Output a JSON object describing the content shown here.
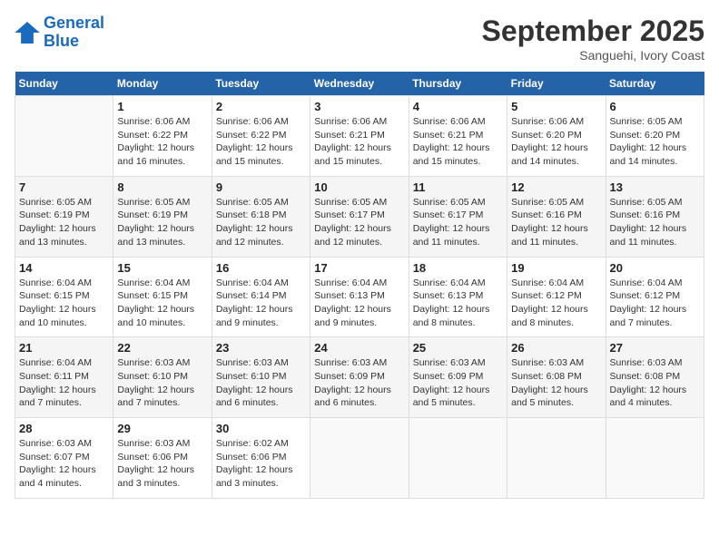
{
  "header": {
    "logo_line1": "General",
    "logo_line2": "Blue",
    "month_year": "September 2025",
    "location": "Sanguehi, Ivory Coast"
  },
  "weekdays": [
    "Sunday",
    "Monday",
    "Tuesday",
    "Wednesday",
    "Thursday",
    "Friday",
    "Saturday"
  ],
  "weeks": [
    [
      {
        "day": "",
        "sunrise": "",
        "sunset": "",
        "daylight": ""
      },
      {
        "day": "1",
        "sunrise": "6:06 AM",
        "sunset": "6:22 PM",
        "daylight": "12 hours and 16 minutes."
      },
      {
        "day": "2",
        "sunrise": "6:06 AM",
        "sunset": "6:22 PM",
        "daylight": "12 hours and 15 minutes."
      },
      {
        "day": "3",
        "sunrise": "6:06 AM",
        "sunset": "6:21 PM",
        "daylight": "12 hours and 15 minutes."
      },
      {
        "day": "4",
        "sunrise": "6:06 AM",
        "sunset": "6:21 PM",
        "daylight": "12 hours and 15 minutes."
      },
      {
        "day": "5",
        "sunrise": "6:06 AM",
        "sunset": "6:20 PM",
        "daylight": "12 hours and 14 minutes."
      },
      {
        "day": "6",
        "sunrise": "6:05 AM",
        "sunset": "6:20 PM",
        "daylight": "12 hours and 14 minutes."
      }
    ],
    [
      {
        "day": "7",
        "sunrise": "6:05 AM",
        "sunset": "6:19 PM",
        "daylight": "12 hours and 13 minutes."
      },
      {
        "day": "8",
        "sunrise": "6:05 AM",
        "sunset": "6:19 PM",
        "daylight": "12 hours and 13 minutes."
      },
      {
        "day": "9",
        "sunrise": "6:05 AM",
        "sunset": "6:18 PM",
        "daylight": "12 hours and 12 minutes."
      },
      {
        "day": "10",
        "sunrise": "6:05 AM",
        "sunset": "6:17 PM",
        "daylight": "12 hours and 12 minutes."
      },
      {
        "day": "11",
        "sunrise": "6:05 AM",
        "sunset": "6:17 PM",
        "daylight": "12 hours and 11 minutes."
      },
      {
        "day": "12",
        "sunrise": "6:05 AM",
        "sunset": "6:16 PM",
        "daylight": "12 hours and 11 minutes."
      },
      {
        "day": "13",
        "sunrise": "6:05 AM",
        "sunset": "6:16 PM",
        "daylight": "12 hours and 11 minutes."
      }
    ],
    [
      {
        "day": "14",
        "sunrise": "6:04 AM",
        "sunset": "6:15 PM",
        "daylight": "12 hours and 10 minutes."
      },
      {
        "day": "15",
        "sunrise": "6:04 AM",
        "sunset": "6:15 PM",
        "daylight": "12 hours and 10 minutes."
      },
      {
        "day": "16",
        "sunrise": "6:04 AM",
        "sunset": "6:14 PM",
        "daylight": "12 hours and 9 minutes."
      },
      {
        "day": "17",
        "sunrise": "6:04 AM",
        "sunset": "6:13 PM",
        "daylight": "12 hours and 9 minutes."
      },
      {
        "day": "18",
        "sunrise": "6:04 AM",
        "sunset": "6:13 PM",
        "daylight": "12 hours and 8 minutes."
      },
      {
        "day": "19",
        "sunrise": "6:04 AM",
        "sunset": "6:12 PM",
        "daylight": "12 hours and 8 minutes."
      },
      {
        "day": "20",
        "sunrise": "6:04 AM",
        "sunset": "6:12 PM",
        "daylight": "12 hours and 7 minutes."
      }
    ],
    [
      {
        "day": "21",
        "sunrise": "6:04 AM",
        "sunset": "6:11 PM",
        "daylight": "12 hours and 7 minutes."
      },
      {
        "day": "22",
        "sunrise": "6:03 AM",
        "sunset": "6:10 PM",
        "daylight": "12 hours and 7 minutes."
      },
      {
        "day": "23",
        "sunrise": "6:03 AM",
        "sunset": "6:10 PM",
        "daylight": "12 hours and 6 minutes."
      },
      {
        "day": "24",
        "sunrise": "6:03 AM",
        "sunset": "6:09 PM",
        "daylight": "12 hours and 6 minutes."
      },
      {
        "day": "25",
        "sunrise": "6:03 AM",
        "sunset": "6:09 PM",
        "daylight": "12 hours and 5 minutes."
      },
      {
        "day": "26",
        "sunrise": "6:03 AM",
        "sunset": "6:08 PM",
        "daylight": "12 hours and 5 minutes."
      },
      {
        "day": "27",
        "sunrise": "6:03 AM",
        "sunset": "6:08 PM",
        "daylight": "12 hours and 4 minutes."
      }
    ],
    [
      {
        "day": "28",
        "sunrise": "6:03 AM",
        "sunset": "6:07 PM",
        "daylight": "12 hours and 4 minutes."
      },
      {
        "day": "29",
        "sunrise": "6:03 AM",
        "sunset": "6:06 PM",
        "daylight": "12 hours and 3 minutes."
      },
      {
        "day": "30",
        "sunrise": "6:02 AM",
        "sunset": "6:06 PM",
        "daylight": "12 hours and 3 minutes."
      },
      {
        "day": "",
        "sunrise": "",
        "sunset": "",
        "daylight": ""
      },
      {
        "day": "",
        "sunrise": "",
        "sunset": "",
        "daylight": ""
      },
      {
        "day": "",
        "sunrise": "",
        "sunset": "",
        "daylight": ""
      },
      {
        "day": "",
        "sunrise": "",
        "sunset": "",
        "daylight": ""
      }
    ]
  ]
}
